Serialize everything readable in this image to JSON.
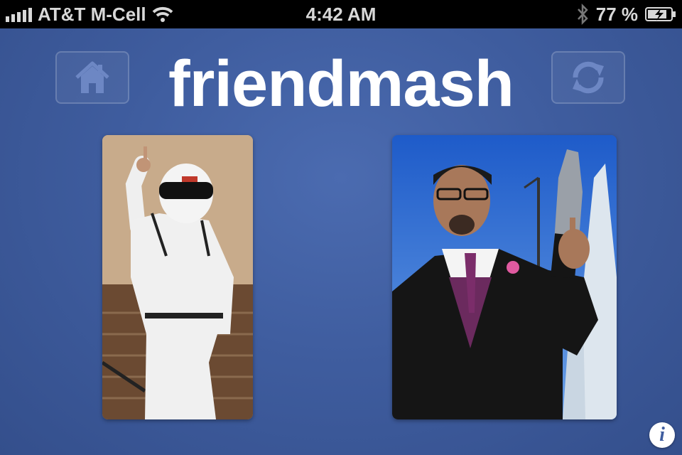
{
  "status_bar": {
    "carrier": "AT&T M-Cell",
    "time": "4:42 AM",
    "battery_percent": "77 %",
    "icons": [
      "signal-icon",
      "wifi-icon",
      "bluetooth-icon",
      "battery-charging-icon"
    ]
  },
  "header": {
    "title": "friendmash",
    "left_button_icon": "home-icon",
    "right_button_icon": "refresh-icon"
  },
  "photos": [
    {
      "name": "left-friend-photo",
      "description_icon": "photo"
    },
    {
      "name": "right-friend-photo",
      "description_icon": "photo"
    }
  ],
  "footer": {
    "info_label": "i"
  },
  "colors": {
    "background": "#3f5d9f",
    "title": "#ffffff",
    "status_bar": "#000000"
  }
}
